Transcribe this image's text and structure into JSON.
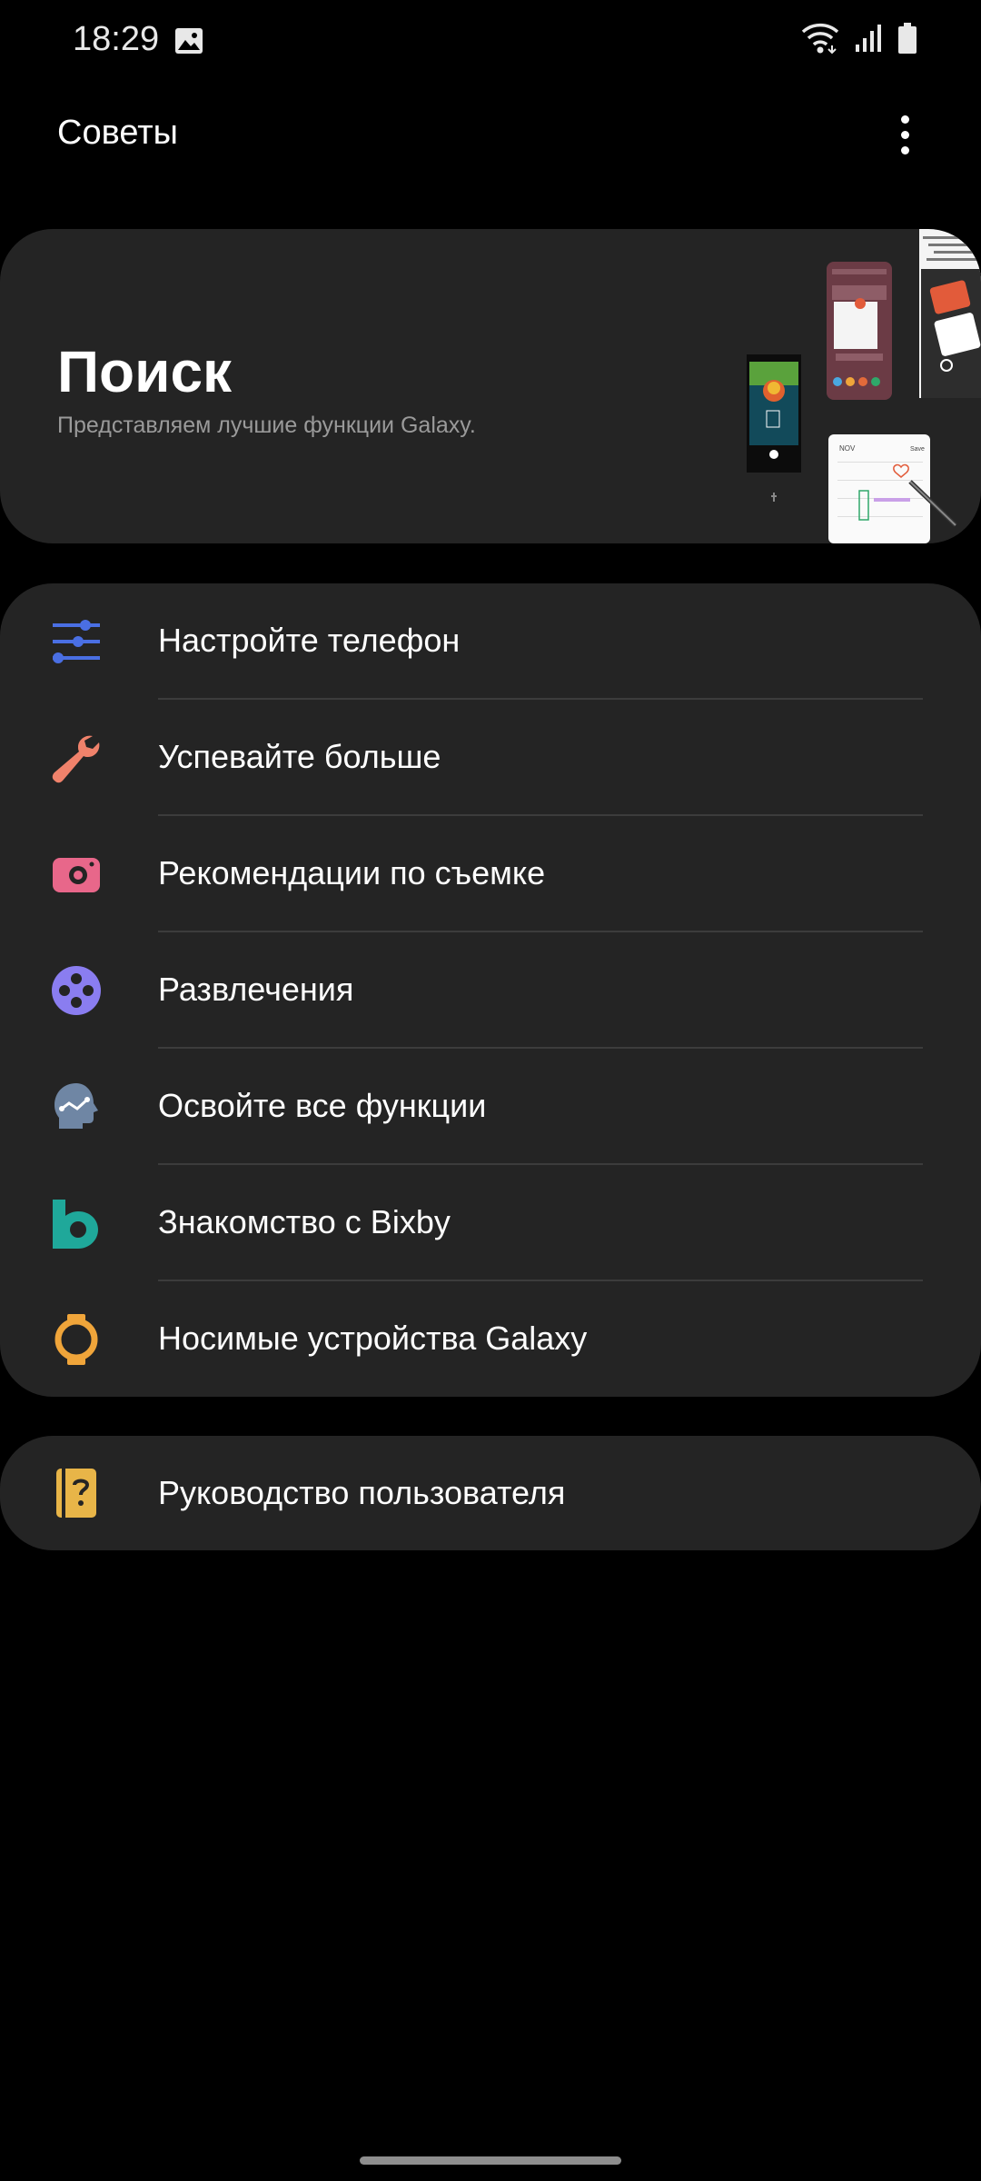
{
  "status_bar": {
    "time": "18:29",
    "icons": [
      "gallery-icon",
      "wifi-icon",
      "signal-icon",
      "battery-icon"
    ]
  },
  "header": {
    "title": "Советы",
    "more_icon": "more-vertical-icon"
  },
  "hero": {
    "title": "Поиск",
    "subtitle": "Представляем лучшие функции Galaxy.",
    "preview_texts": [
      "NOV",
      "Save"
    ]
  },
  "menu": {
    "items": [
      {
        "label": "Настройте телефон",
        "icon": "sliders-icon",
        "color": "#4a6fe3"
      },
      {
        "label": "Успевайте больше",
        "icon": "wrench-icon",
        "color": "#f0826b"
      },
      {
        "label": "Рекомендации по съемке",
        "icon": "camera-icon",
        "color": "#e8678a"
      },
      {
        "label": "Развлечения",
        "icon": "gamepad-icon",
        "color": "#8a7df0"
      },
      {
        "label": "Освойте все функции",
        "icon": "head-icon",
        "color": "#6f86a4"
      },
      {
        "label": "Знакомство с Bixby",
        "icon": "bixby-icon",
        "color": "#1fa89a"
      },
      {
        "label": "Носимые устройства Galaxy",
        "icon": "watch-icon",
        "color": "#f0a53a"
      }
    ]
  },
  "guide": {
    "label": "Руководство пользователя",
    "icon": "user-guide-icon",
    "color": "#e8b548"
  }
}
